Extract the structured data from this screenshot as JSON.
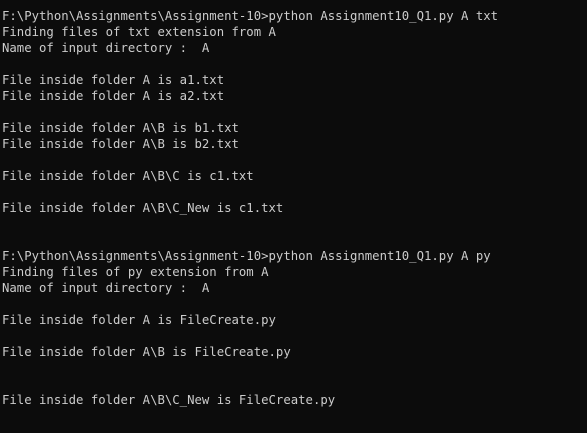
{
  "terminal": {
    "lines": [
      "F:\\Python\\Assignments\\Assignment-10>python Assignment10_Q1.py A txt",
      "Finding files of txt extension from A",
      "Name of input directory :  A",
      "",
      "File inside folder A is a1.txt",
      "File inside folder A is a2.txt",
      "",
      "File inside folder A\\B is b1.txt",
      "File inside folder A\\B is b2.txt",
      "",
      "File inside folder A\\B\\C is c1.txt",
      "",
      "File inside folder A\\B\\C_New is c1.txt",
      "",
      "",
      "F:\\Python\\Assignments\\Assignment-10>python Assignment10_Q1.py A py",
      "Finding files of py extension from A",
      "Name of input directory :  A",
      "",
      "File inside folder A is FileCreate.py",
      "",
      "File inside folder A\\B is FileCreate.py",
      "",
      "",
      "File inside folder A\\B\\C_New is FileCreate.py"
    ]
  }
}
